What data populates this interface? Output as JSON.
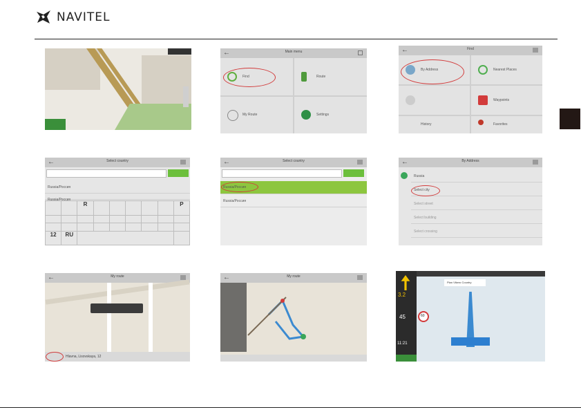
{
  "brand": {
    "name": "NAVITEL"
  },
  "screens": {
    "menu": {
      "title": "Main menu",
      "tiles": [
        "Find",
        "Route",
        "My Route",
        "Settings"
      ]
    },
    "find": {
      "title": "Find",
      "tiles": [
        "By Address",
        "Nearest Places",
        "",
        "Waypoints",
        "History",
        "Favorites"
      ]
    },
    "country1": {
      "title": "Select country",
      "items": [
        "Russia/Россия",
        "Russia/Россия"
      ],
      "key_wide": "P",
      "key_r": "R",
      "key_num": "12",
      "key_lang": "RU"
    },
    "country2": {
      "title": "Select country",
      "items": [
        "Russia/Россия",
        "Russia/Россия"
      ]
    },
    "byaddr": {
      "title": "By Address",
      "items": [
        "Russia",
        "Select city",
        "Select street",
        "Select building",
        "Select crossing"
      ]
    },
    "route1": {
      "title": "My route",
      "footer": "Hlavna, Lisovskaya, 12"
    },
    "route2": {
      "title": "My route"
    },
    "nav": {
      "banner": "Plan Vikero Country",
      "speed": "45",
      "dist": "3.2",
      "time": "11:21",
      "limit": "60"
    }
  }
}
